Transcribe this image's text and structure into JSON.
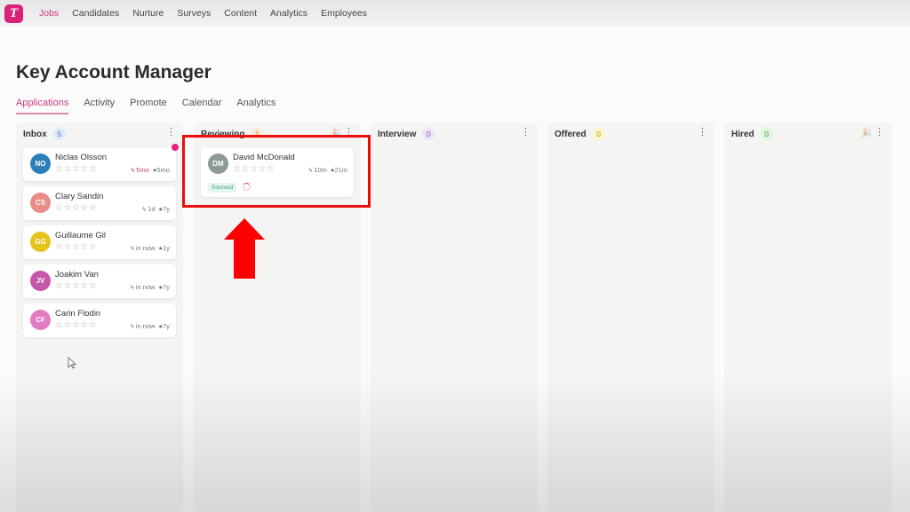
{
  "app": {
    "logo_letter": "T",
    "brand_color": "#d7237a"
  },
  "topnav": {
    "items": [
      {
        "label": "Jobs",
        "active": true
      },
      {
        "label": "Candidates"
      },
      {
        "label": "Nurture"
      },
      {
        "label": "Surveys"
      },
      {
        "label": "Content"
      },
      {
        "label": "Analytics"
      },
      {
        "label": "Employees"
      }
    ]
  },
  "page": {
    "title": "Key Account Manager",
    "subtabs": [
      {
        "label": "Applications",
        "active": true
      },
      {
        "label": "Activity"
      },
      {
        "label": "Promote"
      },
      {
        "label": "Calendar"
      },
      {
        "label": "Analytics"
      }
    ]
  },
  "board": {
    "columns": [
      {
        "title": "Inbox",
        "count": "5",
        "count_bg": "#dfe9fb",
        "count_color": "#4b74c9",
        "cards": [
          {
            "initials": "NO",
            "name": "Niclas Olsson",
            "avatar_color": "#2d7fb8",
            "activity": "5mo",
            "age": "5mo",
            "alert": true
          },
          {
            "initials": "CS",
            "name": "Clary Sandin",
            "avatar_color": "#e98b86",
            "activity": "1d",
            "age": "7y"
          },
          {
            "initials": "GG",
            "name": "Guillaume Gil",
            "avatar_color": "#e6c41d",
            "activity": "in now",
            "age": "1y"
          },
          {
            "initials": "JV",
            "name": "Joakim Van",
            "avatar_color": "#c558a8",
            "activity": "in now",
            "age": "7y"
          },
          {
            "initials": "CF",
            "name": "Carin Flodin",
            "avatar_color": "#e27bc2",
            "activity": "in now",
            "age": "7y"
          }
        ]
      },
      {
        "title": "Reviewing",
        "count": "1",
        "count_bg": "#fde9d6",
        "count_color": "#d9822b",
        "cards": [
          {
            "initials": "DM",
            "name": "David McDonald",
            "avatar_color": "#8e9a96",
            "activity": "10m",
            "age": "21m",
            "tag": "Sourced"
          }
        ]
      },
      {
        "title": "Interview",
        "count": "0",
        "count_bg": "#ece3fa",
        "count_color": "#8459c9",
        "cards": []
      },
      {
        "title": "Offered",
        "count": "0",
        "count_bg": "#fbf6c8",
        "count_color": "#a89515",
        "cards": []
      },
      {
        "title": "Hired",
        "count": "0",
        "count_bg": "#dff5dc",
        "count_color": "#3f9a3a",
        "cards": []
      }
    ]
  },
  "icons": {
    "stars": "☆☆☆☆☆",
    "menu": "⋮",
    "bolt": "ϟ",
    "clock": "●",
    "celebrate": "🎉"
  }
}
